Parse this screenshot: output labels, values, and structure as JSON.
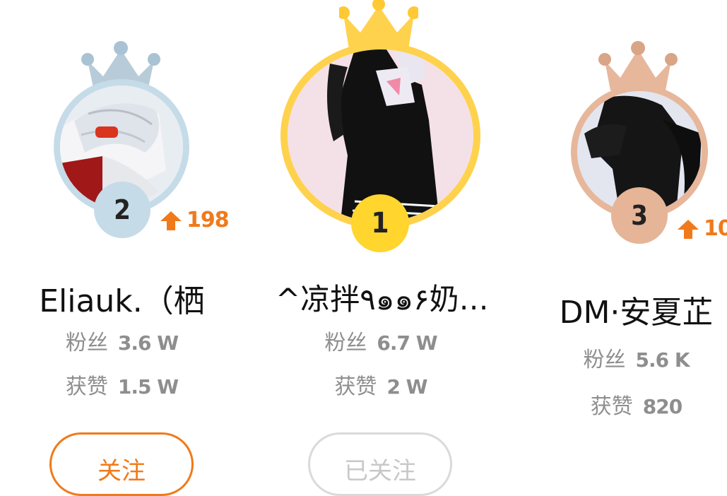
{
  "colors": {
    "accent": "#f07a1a",
    "gold": "#ffd24d",
    "silver": "#c6dbe8",
    "bronze": "#e7b79b"
  },
  "leaderboard": [
    {
      "rank": "2",
      "name": "Eliauk.（栖",
      "fans_label": "粉丝",
      "fans_value": "3.6 W",
      "likes_label": "获赞",
      "likes_value": "1.5 W",
      "delta_icon": "arrow-up-icon",
      "delta": "198",
      "button_label": "关注",
      "button_state": "follow"
    },
    {
      "rank": "1",
      "name": "^凉拌٩๑๑۶奶…",
      "fans_label": "粉丝",
      "fans_value": "6.7 W",
      "likes_label": "获赞",
      "likes_value": "2 W",
      "button_label": "已关注",
      "button_state": "followed"
    },
    {
      "rank": "3",
      "name": "DM·安夏芷",
      "fans_label": "粉丝",
      "fans_value": "5.6 K",
      "likes_label": "获赞",
      "likes_value": "820",
      "delta_icon": "arrow-up-icon",
      "delta": "10"
    }
  ]
}
